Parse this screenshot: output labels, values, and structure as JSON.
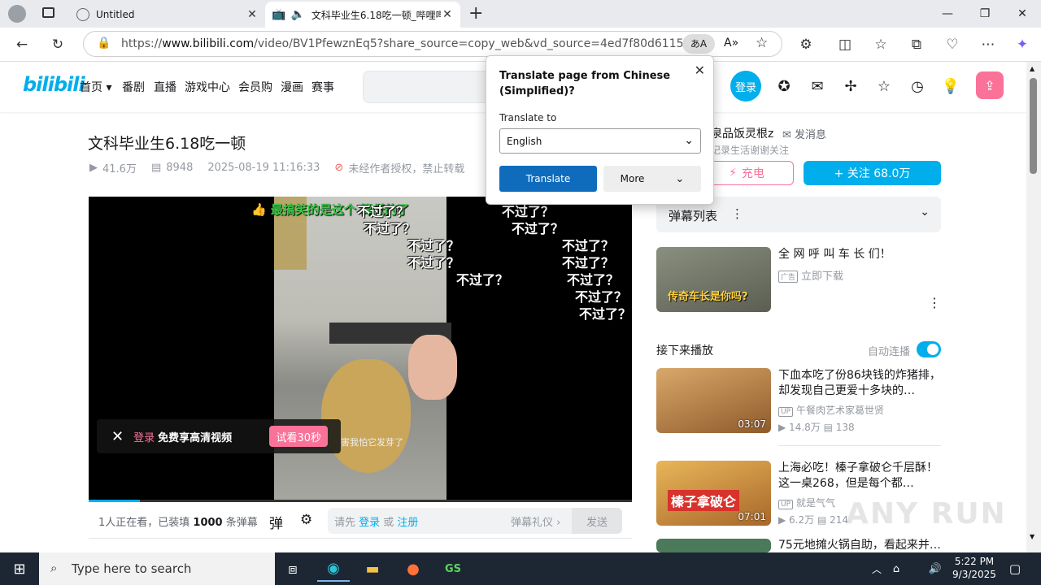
{
  "browser": {
    "tabs": [
      {
        "title": "Untitled"
      },
      {
        "title": "文科毕业生6.18吃一顿_哔哩哔哩_bilibili"
      }
    ],
    "url_prefix": "https://",
    "url_domain": "www.bilibili.com",
    "url_path": "/video/BV1PfewznEq5?share_source=copy_web&vd_source=4ed7f80d61155b7c7eee..."
  },
  "header": {
    "logo": "bilibili",
    "nav": [
      "首页",
      "番剧",
      "直播",
      "游戏中心",
      "会员购",
      "漫画",
      "赛事"
    ],
    "login": "登录"
  },
  "video": {
    "title": "文科毕业生6.18吃一顿",
    "views": "41.6万",
    "danmaku": "8948",
    "date": "2025-08-19 11:16:33",
    "copyright": "未经作者授权，禁止转载",
    "danmaku_top": "最搞笑的是这个  算低的了",
    "danmaku_repeat": "不过了？",
    "subtitle": "害我怕它发芽了",
    "login_prompt_login": "登录",
    "login_prompt_text": "免费享高清视频",
    "try_button": "试看30秒",
    "progress": 0.095
  },
  "danmaku_bar": {
    "watching": "1人正在看，已装填 ",
    "count": "1000",
    "unit": " 条弹幕",
    "placeholder_pre": "请先 ",
    "login": "登录",
    "or": " 或 ",
    "register": "注册",
    "etiquette": "弹幕礼仪 ›",
    "send": "发送"
  },
  "uploader": {
    "name": "泉品饭灵根z",
    "message": "发消息",
    "desc": "记录生活谢谢关注",
    "charge": "充电",
    "follow": "+ 关注 68.0万"
  },
  "danmaku_list": {
    "label": "弹幕列表"
  },
  "ad": {
    "title": "全 网 呼 叫 车 长 们！",
    "badge": "广告",
    "cta": "立即下载",
    "thumb_text": "传奇车长是你吗?"
  },
  "up_next": {
    "label": "接下来播放",
    "autoplay": "自动连播",
    "items": [
      {
        "title": "下血本吃了份86块钱的炸猪排，却发现自己更爱十多块的…",
        "up": "午餐肉艺术家葛世贤",
        "views": "14.8万",
        "comments": "138",
        "duration": "03:07"
      },
      {
        "title": "上海必吃！榛子拿破仑千层酥！这一桌268，但是每个都…",
        "up": "就是气气",
        "views": "6.2万",
        "comments": "214",
        "duration": "07:01",
        "thumb_text": "榛子拿破仑"
      },
      {
        "title": "75元地摊火锅自助，看起来并…"
      }
    ]
  },
  "translate_popup": {
    "heading": "Translate page from Chinese (Simplified)?",
    "label": "Translate to",
    "language": "English",
    "translate": "Translate",
    "more": "More"
  },
  "taskbar": {
    "search_placeholder": "Type here to search",
    "time": "5:22 PM",
    "date": "9/3/2025"
  },
  "watermark": "ANY RUN"
}
